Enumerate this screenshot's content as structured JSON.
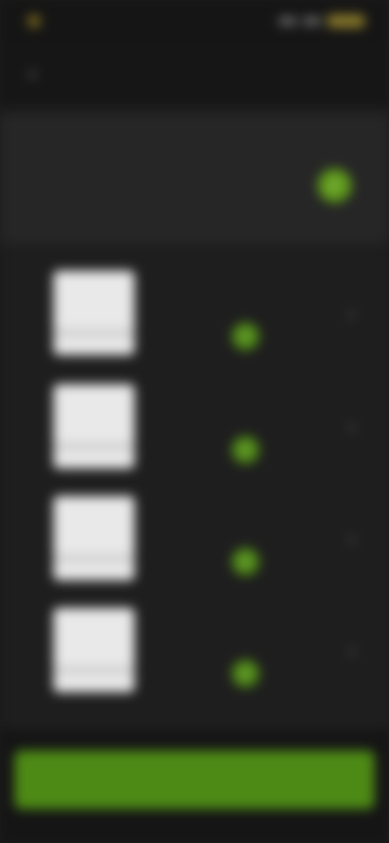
{
  "status_bar": {
    "time": ""
  },
  "header": {
    "title": "",
    "back_icon": "chevron-left-icon"
  },
  "summary": {
    "label": "",
    "value": "",
    "right_label": "",
    "right_value": "",
    "check_icon": "check-icon"
  },
  "items": [
    {
      "title": "",
      "meta": "",
      "check_icon": "check-icon",
      "chevron_icon": "chevron-right-icon"
    },
    {
      "title": "",
      "meta": "",
      "check_icon": "check-icon",
      "chevron_icon": "chevron-right-icon"
    },
    {
      "title": "",
      "meta": "",
      "check_icon": "check-icon",
      "chevron_icon": "chevron-right-icon"
    },
    {
      "title": "",
      "meta": "",
      "check_icon": "check-icon",
      "chevron_icon": "chevron-right-icon"
    }
  ],
  "footer": {
    "primary_button_label": ""
  },
  "colors": {
    "accent": "#4d8a15",
    "background": "#1c1c1c",
    "card": "#262626"
  }
}
